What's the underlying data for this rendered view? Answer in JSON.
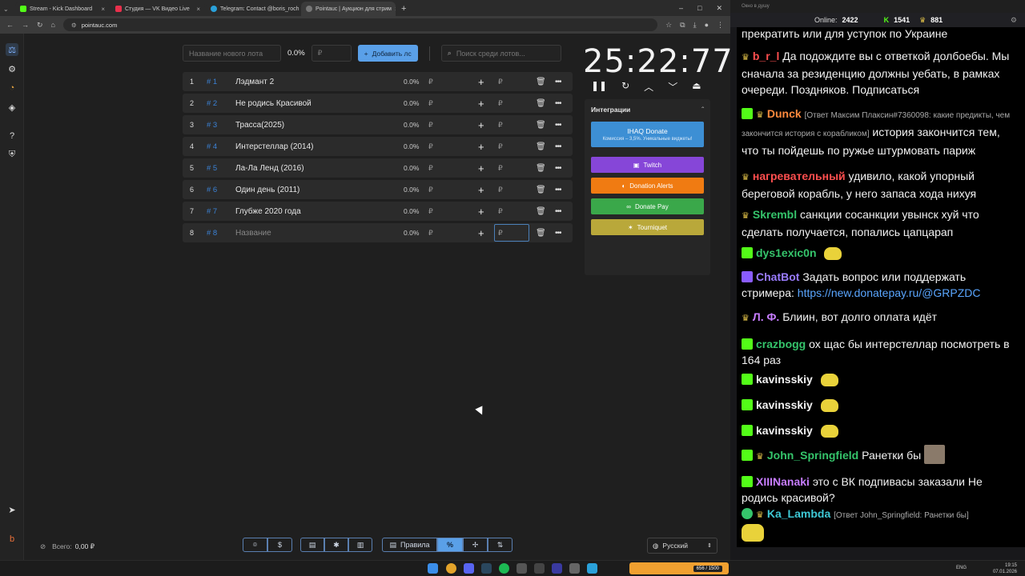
{
  "tabs": [
    {
      "title": "Stream - Kick Dashboard",
      "color": "#53fc18"
    },
    {
      "title": "Студия — VK Видео Live",
      "color": "#e8304c"
    },
    {
      "title": "Telegram: Contact @boris_roch",
      "color": "#2aa1da"
    },
    {
      "title": "Pointauc | Аукцион для стрим",
      "color": "#777777"
    }
  ],
  "url": "pointauc.com",
  "controls": {
    "lot_name_placeholder": "Название нового лота",
    "percent": "0.0%",
    "rub_placeholder": "₽",
    "add_button": "Добавить лс",
    "search_placeholder": "Поиск среди лотов..."
  },
  "lots": [
    {
      "n": "1",
      "hash": "# 1",
      "name": "Лэдмант 2",
      "pct": "0.0%",
      "rub": "₽"
    },
    {
      "n": "2",
      "hash": "# 2",
      "name": "Не родись Красивой",
      "pct": "0.0%",
      "rub": "₽"
    },
    {
      "n": "3",
      "hash": "# 3",
      "name": "Трасса(2025)",
      "pct": "0.0%",
      "rub": "₽"
    },
    {
      "n": "4",
      "hash": "# 4",
      "name": "Интерстеллар (2014)",
      "pct": "0.0%",
      "rub": "₽"
    },
    {
      "n": "5",
      "hash": "# 5",
      "name": "Ла-Ла Ленд (2016)",
      "pct": "0.0%",
      "rub": "₽"
    },
    {
      "n": "6",
      "hash": "# 6",
      "name": "Один день (2011)",
      "pct": "0.0%",
      "rub": "₽"
    },
    {
      "n": "7",
      "hash": "# 7",
      "name": "Глубже 2020 года",
      "pct": "0.0%",
      "rub": "₽"
    },
    {
      "n": "8",
      "hash": "# 8",
      "name": "Название",
      "pct": "0.0%",
      "rub": "₽"
    }
  ],
  "timer": "25:22:77",
  "integrations": {
    "title": "Интеграции",
    "ihaq_title": "IHAQ Donate",
    "ihaq_sub": "Комиссия – 3,5%. Уникальные виджеты!",
    "twitch": "Twitch",
    "donation_alerts": "Donation Alerts",
    "donate_pay": "Donate Pay",
    "tourniquet": "Tourniquet"
  },
  "bottom": {
    "total_label": "Всего:",
    "total_value": "0,00 ₽",
    "rules": "Правила",
    "percent": "%",
    "language": "Русский"
  },
  "chat": {
    "window_title": "Окно в душу",
    "online_label": "Online:",
    "online": "2422",
    "kick_count": "1541",
    "vk_count": "881",
    "messages": [
      {
        "user": "",
        "color": "#ffffff",
        "text": "прекратить или для уступок по Украине",
        "reply": ""
      },
      {
        "user": "b_r_l",
        "color": "#ff4f4f",
        "text": "Да подождите вы с ответкой долбоебы. Мы сначала за резиденцию должны уебать, в рамках очереди. Поздняков. Подписаться",
        "reply": ""
      },
      {
        "user": "Dunck",
        "color": "#ff8a3d",
        "text": "история закончится тем, что ты пойдешь по ружье штурмовать париж",
        "reply": "[Ответ Максим Плаксин#7360098: какие предикты, чем закончится история с корабликом]"
      },
      {
        "user": "нагревательный",
        "color": "#ff4f4f",
        "text": "удивило, какой упорный береговой корабль, у него запаса хода нихуя",
        "reply": ""
      },
      {
        "user": "Skrembl",
        "color": "#35c46b",
        "text": "санкции сосанкции увынск хуй что сделать получается, попались цапцарап",
        "reply": ""
      },
      {
        "user": "dys1exic0n",
        "color": "#35c46b",
        "text": "",
        "reply": ""
      },
      {
        "user": "ChatBot",
        "color": "#9a7cff",
        "text": "Задать вопрос или поддержать стримера:",
        "reply": "",
        "link": "https://new.donatepay.ru/@GRPZDC"
      },
      {
        "user": "Л. Ф.",
        "color": "#c77dff",
        "text": "Блиин, вот долго оплата идёт",
        "reply": ""
      },
      {
        "user": "crazbogg",
        "color": "#35c46b",
        "text": "ох щас бы интерстеллар посмотреть в 164 раз",
        "reply": ""
      },
      {
        "user": "kavinsskiy",
        "color": "#f2f2f2",
        "text": "",
        "reply": ""
      },
      {
        "user": "kavinsskiy",
        "color": "#f2f2f2",
        "text": "",
        "reply": ""
      },
      {
        "user": "kavinsskiy",
        "color": "#f2f2f2",
        "text": "",
        "reply": ""
      },
      {
        "user": "John_Springfield",
        "color": "#35c46b",
        "text": "Ранетки бы",
        "reply": ""
      },
      {
        "user": "XIIINanaki",
        "color": "#c77dff",
        "text": "это с ВК подпивасы заказали Не родись красивой?",
        "reply": ""
      },
      {
        "user": "Ka_Lambda",
        "color": "#3ec9d6",
        "text": "",
        "reply": "[Ответ John_Springfield: Ранетки бы]"
      }
    ]
  },
  "taskbar": {
    "lang": "ENG",
    "time": "19:15",
    "date": "07.01.2026",
    "meme": "656 / 1500"
  }
}
